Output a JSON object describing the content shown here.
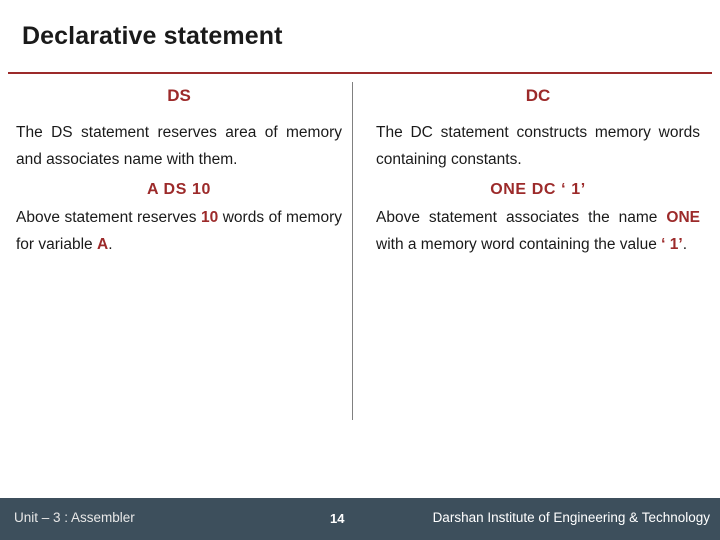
{
  "slide": {
    "title": "Declarative statement",
    "columns": [
      {
        "heading": "DS",
        "para1": "The DS statement reserves area of memory and associates name with them.",
        "code": "A  DS  10",
        "para2_pre": "Above statement reserves ",
        "para2_red1": "10",
        "para2_mid": " words of memory for variable ",
        "para2_red2": "A",
        "para2_post": "."
      },
      {
        "heading": "DC",
        "para1": "The DC statement constructs memory words containing constants.",
        "code": "ONE  DC  ‘ 1’",
        "para2_pre": "Above statement associates the name ",
        "para2_red1": "ONE",
        "para2_mid": " with a memory word containing the value ",
        "para2_red2": "‘ 1’",
        "para2_post": "."
      }
    ]
  },
  "footer": {
    "left": "Unit – 3 : Assembler",
    "page": "14",
    "right": "Darshan Institute of Engineering & Technology"
  }
}
